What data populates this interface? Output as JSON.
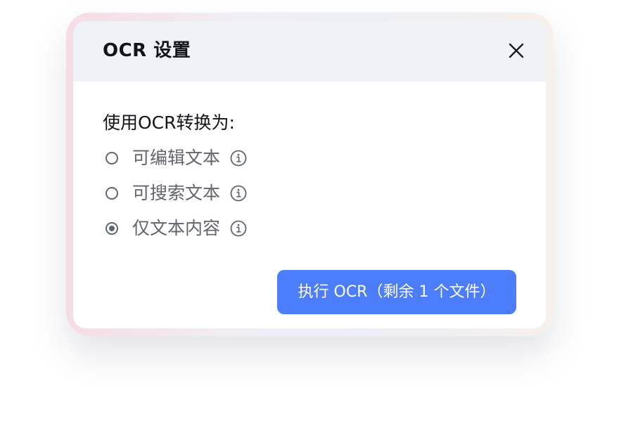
{
  "dialog": {
    "title": "OCR 设置",
    "prompt": "使用OCR转换为:",
    "options": [
      {
        "label": "可编辑文本",
        "selected": false
      },
      {
        "label": "可搜索文本",
        "selected": false
      },
      {
        "label": "仅文本内容",
        "selected": true
      }
    ],
    "run_button": "执行 OCR（剩余 1 个文件）"
  },
  "colors": {
    "accent": "#4c7dfa",
    "header_bg": "#eff2f9",
    "text_primary": "#111418",
    "text_secondary": "#60646c"
  },
  "icons": {
    "close": "close-icon",
    "info": "info-icon"
  }
}
